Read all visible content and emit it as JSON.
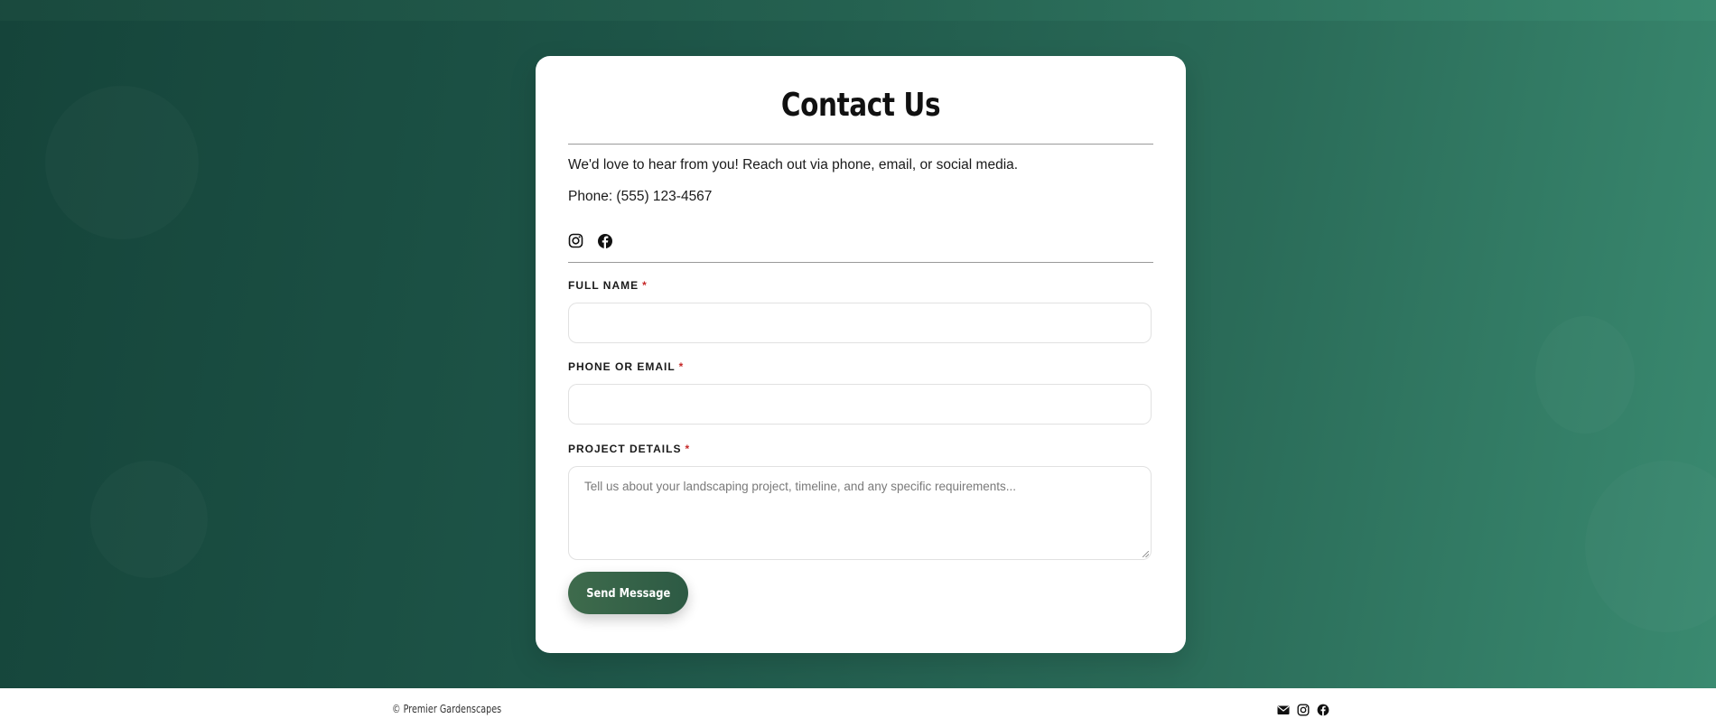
{
  "contact": {
    "title": "Contact Us",
    "intro": "We'd love to hear from you! Reach out via phone, email, or social media.",
    "phone": "Phone: (555) 123-4567",
    "social_icons": [
      "instagram-icon",
      "facebook-icon"
    ]
  },
  "form": {
    "full_name_label": "FULL NAME",
    "phone_email_label": "PHONE OR EMAIL",
    "project_label": "PROJECT DETAILS",
    "required_mark": "*",
    "full_name_value": "",
    "phone_email_value": "",
    "project_placeholder": "Tell us about your landscaping project, timeline, and any specific requirements...",
    "submit_label": "Send Message"
  },
  "footer": {
    "copyright": "© Premier Gardenscapes",
    "icons": [
      "mail-icon",
      "instagram-icon",
      "facebook-icon"
    ]
  },
  "colors": {
    "hero_gradient_start": "#15443a",
    "hero_gradient_end": "#3a8a70",
    "button": "#3e6b4c",
    "required": "#c62828"
  }
}
